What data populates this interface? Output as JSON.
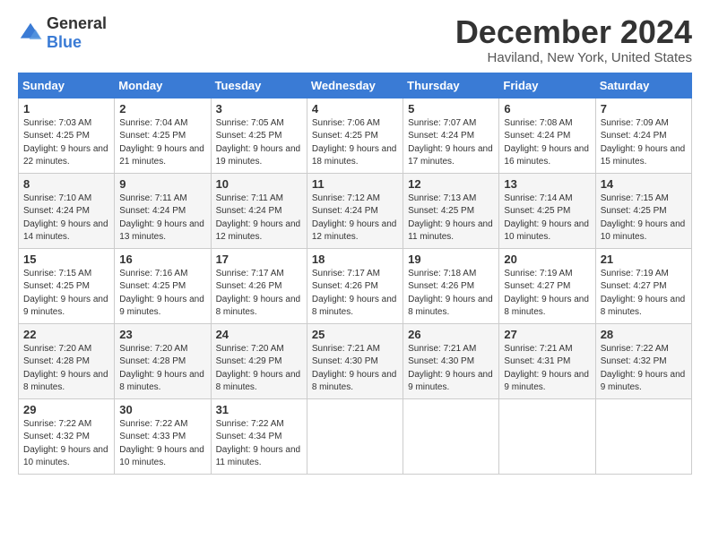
{
  "logo": {
    "general": "General",
    "blue": "Blue"
  },
  "title": "December 2024",
  "location": "Haviland, New York, United States",
  "days_of_week": [
    "Sunday",
    "Monday",
    "Tuesday",
    "Wednesday",
    "Thursday",
    "Friday",
    "Saturday"
  ],
  "weeks": [
    [
      {
        "day": "1",
        "sunrise": "7:03 AM",
        "sunset": "4:25 PM",
        "daylight": "9 hours and 22 minutes."
      },
      {
        "day": "2",
        "sunrise": "7:04 AM",
        "sunset": "4:25 PM",
        "daylight": "9 hours and 21 minutes."
      },
      {
        "day": "3",
        "sunrise": "7:05 AM",
        "sunset": "4:25 PM",
        "daylight": "9 hours and 19 minutes."
      },
      {
        "day": "4",
        "sunrise": "7:06 AM",
        "sunset": "4:25 PM",
        "daylight": "9 hours and 18 minutes."
      },
      {
        "day": "5",
        "sunrise": "7:07 AM",
        "sunset": "4:24 PM",
        "daylight": "9 hours and 17 minutes."
      },
      {
        "day": "6",
        "sunrise": "7:08 AM",
        "sunset": "4:24 PM",
        "daylight": "9 hours and 16 minutes."
      },
      {
        "day": "7",
        "sunrise": "7:09 AM",
        "sunset": "4:24 PM",
        "daylight": "9 hours and 15 minutes."
      }
    ],
    [
      {
        "day": "8",
        "sunrise": "7:10 AM",
        "sunset": "4:24 PM",
        "daylight": "9 hours and 14 minutes."
      },
      {
        "day": "9",
        "sunrise": "7:11 AM",
        "sunset": "4:24 PM",
        "daylight": "9 hours and 13 minutes."
      },
      {
        "day": "10",
        "sunrise": "7:11 AM",
        "sunset": "4:24 PM",
        "daylight": "9 hours and 12 minutes."
      },
      {
        "day": "11",
        "sunrise": "7:12 AM",
        "sunset": "4:24 PM",
        "daylight": "9 hours and 12 minutes."
      },
      {
        "day": "12",
        "sunrise": "7:13 AM",
        "sunset": "4:25 PM",
        "daylight": "9 hours and 11 minutes."
      },
      {
        "day": "13",
        "sunrise": "7:14 AM",
        "sunset": "4:25 PM",
        "daylight": "9 hours and 10 minutes."
      },
      {
        "day": "14",
        "sunrise": "7:15 AM",
        "sunset": "4:25 PM",
        "daylight": "9 hours and 10 minutes."
      }
    ],
    [
      {
        "day": "15",
        "sunrise": "7:15 AM",
        "sunset": "4:25 PM",
        "daylight": "9 hours and 9 minutes."
      },
      {
        "day": "16",
        "sunrise": "7:16 AM",
        "sunset": "4:25 PM",
        "daylight": "9 hours and 9 minutes."
      },
      {
        "day": "17",
        "sunrise": "7:17 AM",
        "sunset": "4:26 PM",
        "daylight": "9 hours and 8 minutes."
      },
      {
        "day": "18",
        "sunrise": "7:17 AM",
        "sunset": "4:26 PM",
        "daylight": "9 hours and 8 minutes."
      },
      {
        "day": "19",
        "sunrise": "7:18 AM",
        "sunset": "4:26 PM",
        "daylight": "9 hours and 8 minutes."
      },
      {
        "day": "20",
        "sunrise": "7:19 AM",
        "sunset": "4:27 PM",
        "daylight": "9 hours and 8 minutes."
      },
      {
        "day": "21",
        "sunrise": "7:19 AM",
        "sunset": "4:27 PM",
        "daylight": "9 hours and 8 minutes."
      }
    ],
    [
      {
        "day": "22",
        "sunrise": "7:20 AM",
        "sunset": "4:28 PM",
        "daylight": "9 hours and 8 minutes."
      },
      {
        "day": "23",
        "sunrise": "7:20 AM",
        "sunset": "4:28 PM",
        "daylight": "9 hours and 8 minutes."
      },
      {
        "day": "24",
        "sunrise": "7:20 AM",
        "sunset": "4:29 PM",
        "daylight": "9 hours and 8 minutes."
      },
      {
        "day": "25",
        "sunrise": "7:21 AM",
        "sunset": "4:30 PM",
        "daylight": "9 hours and 8 minutes."
      },
      {
        "day": "26",
        "sunrise": "7:21 AM",
        "sunset": "4:30 PM",
        "daylight": "9 hours and 9 minutes."
      },
      {
        "day": "27",
        "sunrise": "7:21 AM",
        "sunset": "4:31 PM",
        "daylight": "9 hours and 9 minutes."
      },
      {
        "day": "28",
        "sunrise": "7:22 AM",
        "sunset": "4:32 PM",
        "daylight": "9 hours and 9 minutes."
      }
    ],
    [
      {
        "day": "29",
        "sunrise": "7:22 AM",
        "sunset": "4:32 PM",
        "daylight": "9 hours and 10 minutes."
      },
      {
        "day": "30",
        "sunrise": "7:22 AM",
        "sunset": "4:33 PM",
        "daylight": "9 hours and 10 minutes."
      },
      {
        "day": "31",
        "sunrise": "7:22 AM",
        "sunset": "4:34 PM",
        "daylight": "9 hours and 11 minutes."
      },
      null,
      null,
      null,
      null
    ]
  ]
}
